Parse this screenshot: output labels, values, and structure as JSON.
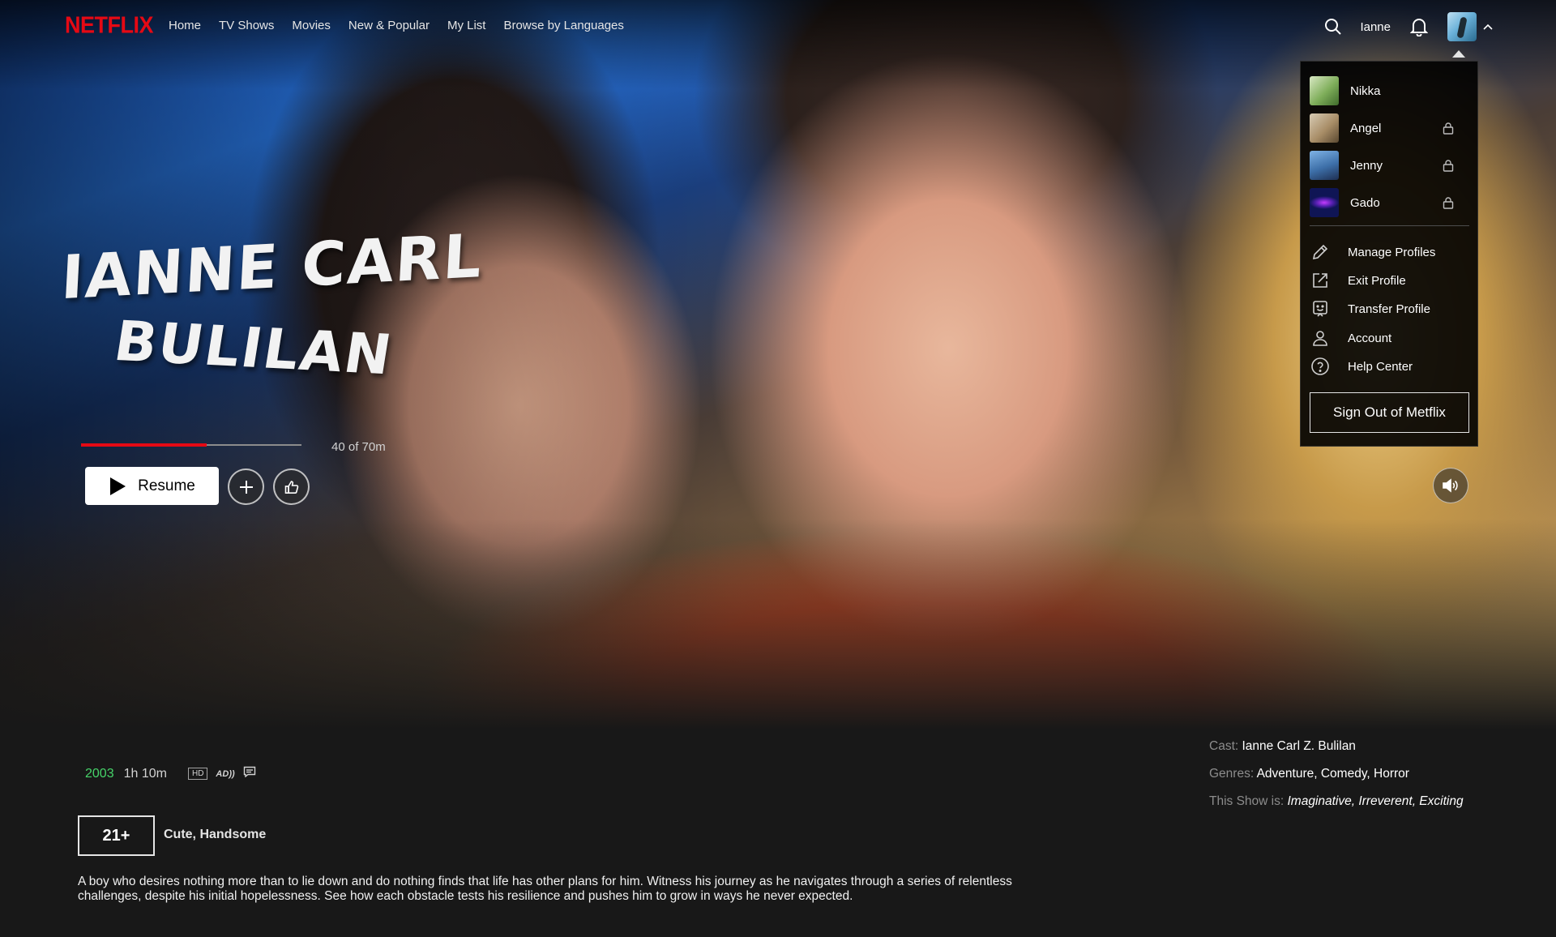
{
  "brand": {
    "logo": "NETFLIX",
    "color": "#e50914"
  },
  "nav": {
    "links": [
      "Home",
      "TV Shows",
      "Movies",
      "New & Popular",
      "My List",
      "Browse by Languages"
    ],
    "username": "Ianne",
    "icons": [
      "search-icon",
      "bell-icon",
      "avatar",
      "caret-up-icon"
    ]
  },
  "profile_menu": {
    "profiles": [
      {
        "name": "Nikka",
        "locked": false
      },
      {
        "name": "Angel",
        "locked": true
      },
      {
        "name": "Jenny",
        "locked": true
      },
      {
        "name": "Gado",
        "locked": true
      }
    ],
    "items": [
      {
        "label": "Manage Profiles",
        "icon": "pencil-icon"
      },
      {
        "label": "Exit Profile",
        "icon": "external-link-icon"
      },
      {
        "label": "Transfer Profile",
        "icon": "transfer-profile-icon"
      },
      {
        "label": "Account",
        "icon": "person-icon"
      },
      {
        "label": "Help Center",
        "icon": "help-circle-icon"
      }
    ],
    "sign_out": "Sign Out of Metflix"
  },
  "title": {
    "line1": "Ianne Carl",
    "line2": "Bulilan"
  },
  "playback": {
    "progress_fraction": 0.571,
    "progress_text": "40 of 70m",
    "resume_label": "Resume",
    "accent": "#e50914"
  },
  "details": {
    "year": "2003",
    "duration": "1h 10m",
    "hd_badge": "HD",
    "ad_badge": "AD",
    "rating": "21+",
    "rating_reasons": "Cute, Handsome",
    "synopsis": "A boy who desires nothing more than to lie down and do nothing finds that life has other plans for him. Witness his journey as he navigates through a series of relentless challenges, despite his initial hopelessness. See how each obstacle tests his resilience and pushes him to grow in ways he never expected.",
    "cast_label": "Cast:",
    "cast": "Ianne Carl Z. Bulilan",
    "genres_label": "Genres:",
    "genres": "Adventure, Comedy, Horror",
    "show_is_label": "This Show is:",
    "show_is": "Imaginative, Irreverent, Exciting",
    "year_color": "#46d369"
  }
}
